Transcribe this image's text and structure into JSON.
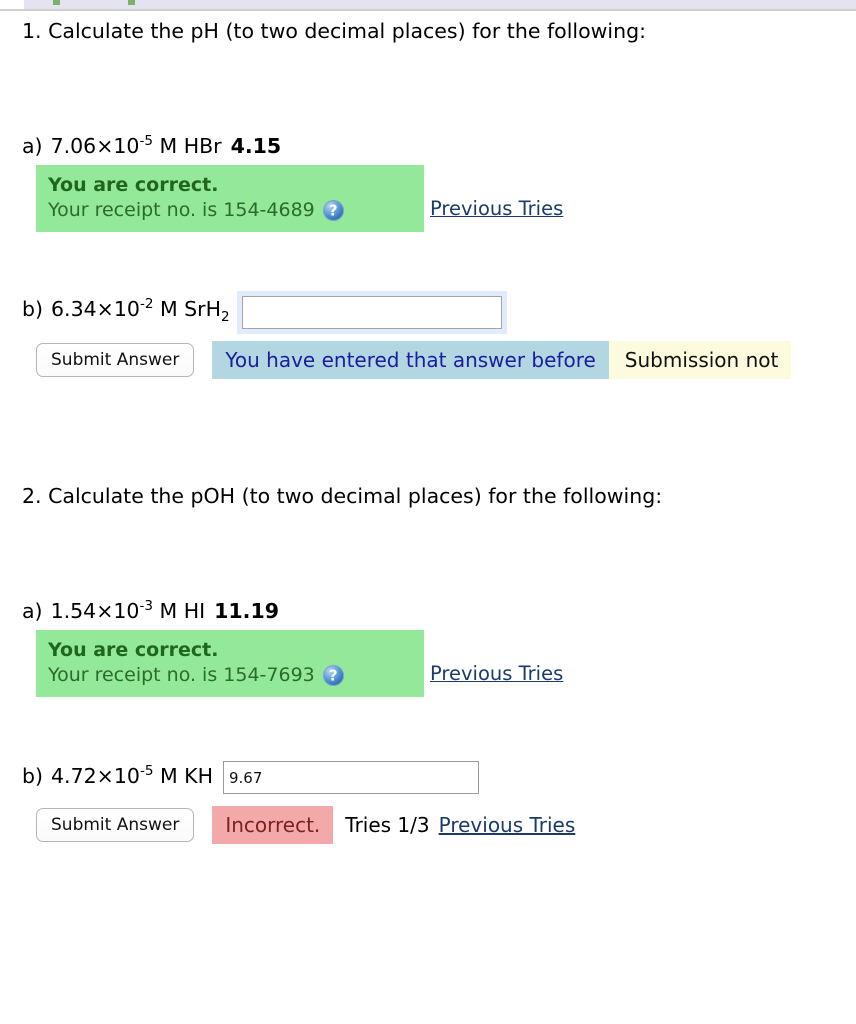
{
  "topbar": {
    "present": true
  },
  "problems": [
    {
      "number": "1.",
      "prompt": "1. Calculate the pH (to two decimal places) for the following:",
      "parts": [
        {
          "label": "a)",
          "conc_mantissa": "7.06×10",
          "conc_exponent": "-5",
          "unit_species": " M HBr",
          "submitted_answer": "4.15",
          "status": "correct",
          "correct_heading": "You are correct.",
          "receipt_text": "Your receipt no. is 154-4689",
          "help_icon": "question-mark-icon",
          "previous_tries_label": "Previous Tries"
        },
        {
          "label": "b)",
          "conc_mantissa": "6.34×10",
          "conc_exponent": "-2",
          "unit_species_pre": " M SrH",
          "unit_species_sub": "2",
          "input_value": "",
          "input_placeholder": "",
          "input_focused": true,
          "submit_label": "Submit Answer",
          "flash_blue": "You have entered that answer before",
          "flash_yellow": "Submission not"
        }
      ]
    },
    {
      "number": "2.",
      "prompt": "2. Calculate the pOH (to two decimal places) for the following:",
      "parts": [
        {
          "label": "a)",
          "conc_mantissa": "1.54×10",
          "conc_exponent": "-3",
          "unit_species": " M HI",
          "submitted_answer": "11.19",
          "status": "correct",
          "correct_heading": "You are correct.",
          "receipt_text": "Your receipt no. is 154-7693",
          "help_icon": "question-mark-icon",
          "previous_tries_label": "Previous Tries"
        },
        {
          "label": "b)",
          "conc_mantissa": "4.72×10",
          "conc_exponent": "-5",
          "unit_species": " M KH",
          "input_value": "9.67",
          "input_focused": false,
          "submit_label": "Submit Answer",
          "flash_red": "Incorrect.",
          "tries_label": "Tries 1/3",
          "previous_tries_label": "Previous Tries"
        }
      ]
    }
  ],
  "colors": {
    "correct_bg": "#93e89a",
    "correct_heading": "#20661f",
    "info_blue_bg": "#b2d6e2",
    "info_blue_text": "#1c1c9c",
    "warn_yellow_bg": "#fcfbdd",
    "incorrect_bg": "#f3a9a9",
    "incorrect_text": "#7c2020",
    "link": "#1b3a6b",
    "topbar_bg": "#e3e3f2"
  }
}
